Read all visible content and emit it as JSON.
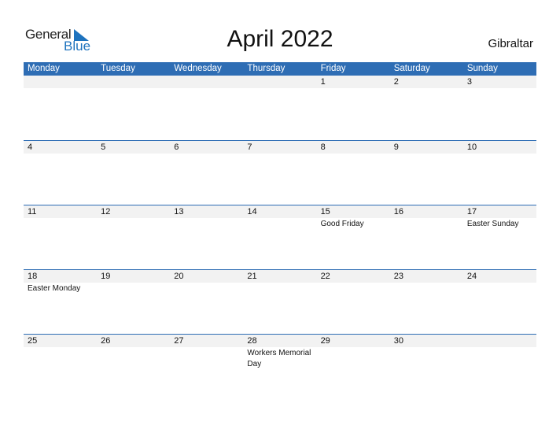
{
  "logo": {
    "general": "General",
    "blue": "Blue"
  },
  "title": "April 2022",
  "country": "Gibraltar",
  "colors": {
    "accent": "#2E6DB4",
    "band": "#f2f2f2"
  },
  "weekdays": [
    "Monday",
    "Tuesday",
    "Wednesday",
    "Thursday",
    "Friday",
    "Saturday",
    "Sunday"
  ],
  "weeks": [
    {
      "days": [
        "",
        "",
        "",
        "",
        "1",
        "2",
        "3"
      ],
      "events": [
        "",
        "",
        "",
        "",
        "",
        "",
        ""
      ]
    },
    {
      "days": [
        "4",
        "5",
        "6",
        "7",
        "8",
        "9",
        "10"
      ],
      "events": [
        "",
        "",
        "",
        "",
        "",
        "",
        ""
      ]
    },
    {
      "days": [
        "11",
        "12",
        "13",
        "14",
        "15",
        "16",
        "17"
      ],
      "events": [
        "",
        "",
        "",
        "",
        "Good Friday",
        "",
        "Easter Sunday"
      ]
    },
    {
      "days": [
        "18",
        "19",
        "20",
        "21",
        "22",
        "23",
        "24"
      ],
      "events": [
        "Easter Monday",
        "",
        "",
        "",
        "",
        "",
        ""
      ]
    },
    {
      "days": [
        "25",
        "26",
        "27",
        "28",
        "29",
        "30",
        ""
      ],
      "events": [
        "",
        "",
        "",
        "Workers Memorial Day",
        "",
        "",
        ""
      ]
    }
  ]
}
